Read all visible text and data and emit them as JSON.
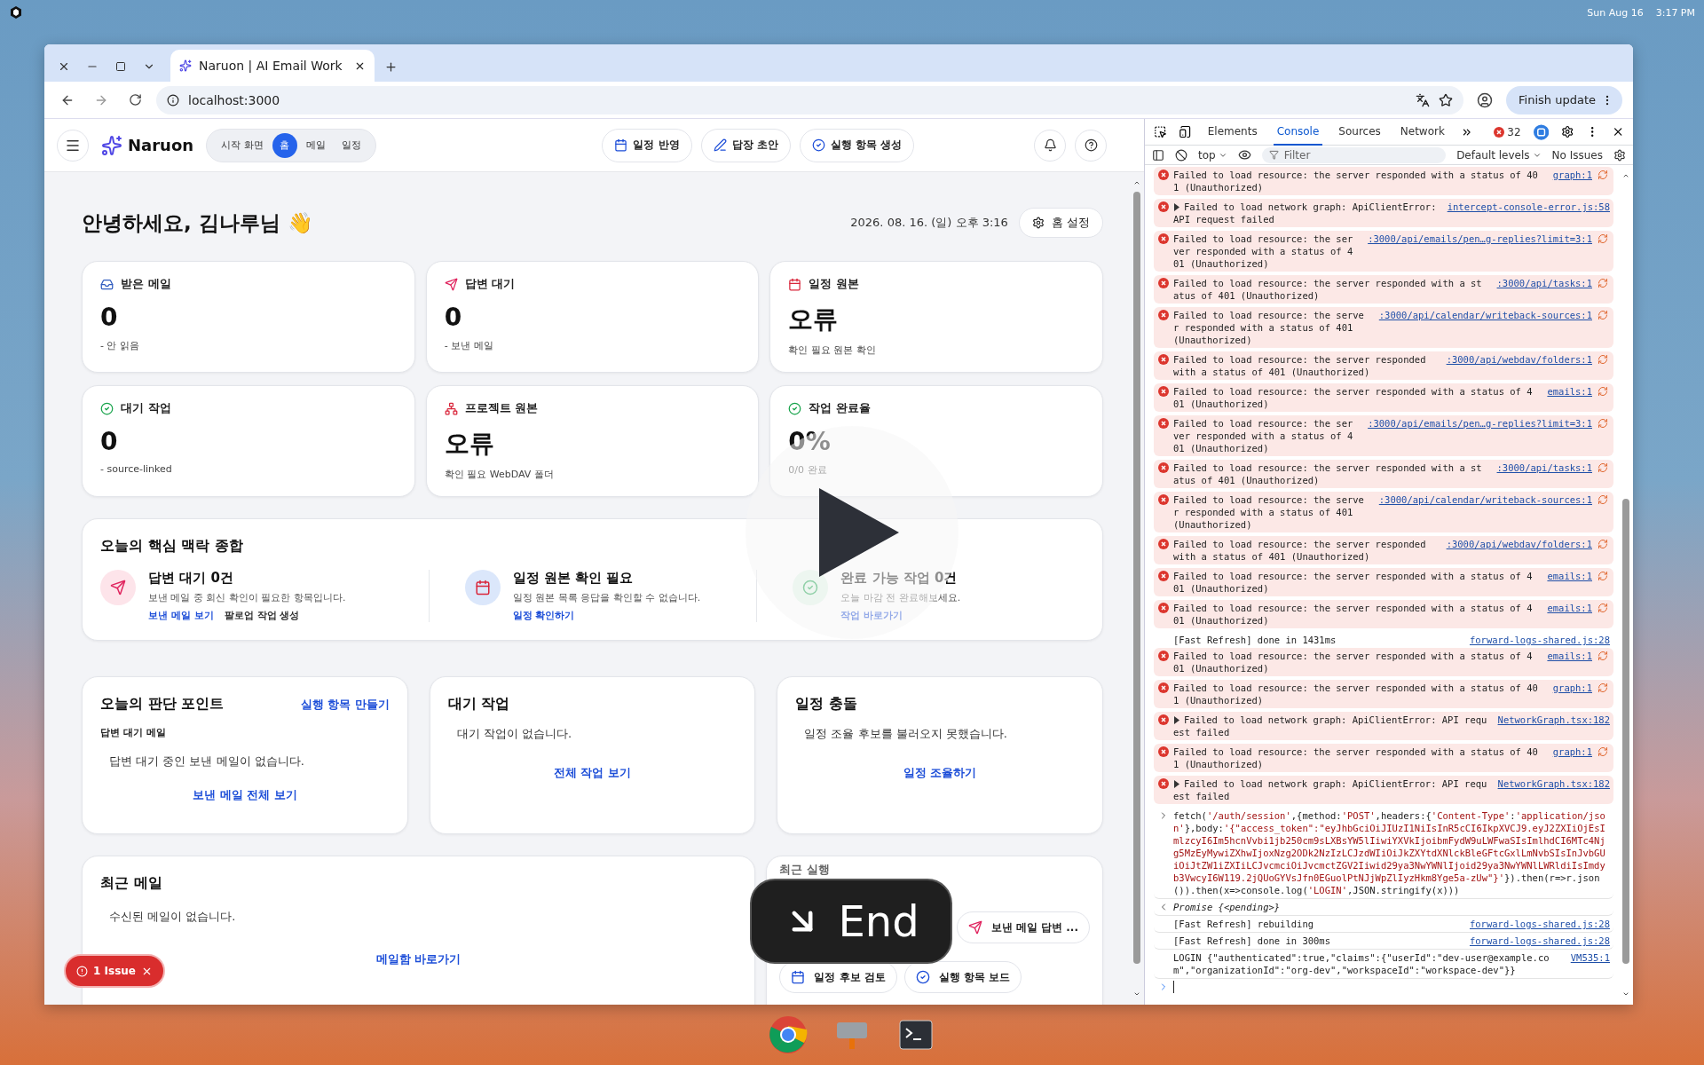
{
  "desktop": {
    "date": "Sun Aug 16",
    "time": "3:17 PM"
  },
  "browser": {
    "tab_title": "Naruon | AI Email Work",
    "address": "localhost:3000",
    "update_button": "Finish update"
  },
  "app": {
    "brand": "Naruon",
    "nav": [
      {
        "label": "시작 화면",
        "selected": false
      },
      {
        "label": "홈",
        "selected": true
      },
      {
        "label": "메일",
        "selected": false
      },
      {
        "label": "일정",
        "selected": false
      }
    ],
    "actions": [
      {
        "label": "일정 반영",
        "kind": "calendar"
      },
      {
        "label": "답장 초안",
        "kind": "pen"
      },
      {
        "label": "실행 항목 생성",
        "kind": "check"
      }
    ],
    "greeting": "안녕하세요, 김나루님 👋",
    "datetime": "2026. 08. 16. (일) 오후 3:16",
    "settings_button": "홈 설정",
    "stats": [
      {
        "label": "받은 메일",
        "value": "0",
        "sub": "- 안 읽음",
        "kind": "inbox"
      },
      {
        "label": "답변 대기",
        "value": "0",
        "sub": "- 보낸 메일",
        "kind": "send"
      },
      {
        "label": "일정 원본",
        "value": "오류",
        "sub": "확인 필요 원본 확인",
        "kind": "calendar"
      },
      {
        "label": "대기 작업",
        "value": "0",
        "sub": "- source-linked",
        "kind": "check"
      },
      {
        "label": "프로젝트 원본",
        "value": "오류",
        "sub": "확인 필요 WebDAV 폴더",
        "kind": "network"
      },
      {
        "label": "작업 완료율",
        "value": "0%",
        "sub": "0/0 완료",
        "kind": "check"
      }
    ],
    "context": {
      "title": "오늘의 핵심 맥락 종합",
      "items": [
        {
          "kind": "send",
          "title": "답변 대기 0건",
          "desc": "보낸 메일 중 회신 확인이 필요한 항목입니다.",
          "links": [
            {
              "label": "보낸 메일 보기",
              "primary": true
            },
            {
              "label": "팔로업 작업 생성",
              "primary": false
            }
          ]
        },
        {
          "kind": "calendar",
          "title": "일정 원본 확인 필요",
          "desc": "일정 원본 목록 응답을 확인할 수 없습니다.",
          "links": [
            {
              "label": "일정 확인하기",
              "primary": true
            }
          ]
        },
        {
          "kind": "check",
          "title": "완료 가능 작업 0건",
          "desc": "오늘 마감 전 완료해보세요.",
          "links": [
            {
              "label": "작업 바로가기",
              "primary": true
            }
          ]
        }
      ]
    },
    "panels": [
      {
        "title": "오늘의 판단 포인트",
        "action": "실행 항목 만들기",
        "subtitle": "답변 대기 메일",
        "message": "답변 대기 중인 보낸 메일이 없습니다.",
        "link": "보낸 메일 전체 보기"
      },
      {
        "title": "대기 작업",
        "message": "대기 작업이 없습니다.",
        "link": "전체 작업 보기"
      },
      {
        "title": "일정 충돌",
        "message": "일정 조율 후보를 불러오지 못했습니다.",
        "link": "일정 조율하기"
      }
    ],
    "recent_mail": {
      "title": "최근 메일",
      "message": "수신된 메일이 없습니다.",
      "link": "메일함 바로가기"
    },
    "recent_runs": {
      "title": "최근 실행",
      "buttons": [
        {
          "label": "보낸 메일 답변 ...",
          "kind": "send"
        },
        {
          "label": "일정 후보 검토",
          "kind": "calendar"
        },
        {
          "label": "실행 항목 보드",
          "kind": "check"
        }
      ]
    },
    "issue_badge": "1 Issue"
  },
  "devtools": {
    "tabs": [
      {
        "label": "Elements",
        "selected": false
      },
      {
        "label": "Console",
        "selected": true
      },
      {
        "label": "Sources",
        "selected": false
      },
      {
        "label": "Network",
        "selected": false
      }
    ],
    "error_count": "32",
    "context": "top",
    "filter_placeholder": "Filter",
    "levels": "Default levels",
    "issues": "No Issues",
    "messages": [
      {
        "kind": "resource_error",
        "text": "Failed to load resource: the server responded with a status of 401 (Unauthorized)",
        "source": "graph:1"
      },
      {
        "kind": "error",
        "expandable": true,
        "text": "Failed to load network graph: ApiClientError: API request failed",
        "source": "intercept-console-error.js:58"
      },
      {
        "kind": "resource_error",
        "text": "Failed to load resource: the server responded with a status of 401 (Unauthorized)",
        "source": ":3000/api/emails/pen…g-replies?limit=3:1"
      },
      {
        "kind": "resource_error",
        "text": "Failed to load resource: the server responded with a status of 401 (Unauthorized)",
        "source": ":3000/api/tasks:1"
      },
      {
        "kind": "resource_error",
        "text": "Failed to load resource: the server responded with a status of 401 (Unauthorized)",
        "source": ":3000/api/calendar/writeback-sources:1"
      },
      {
        "kind": "resource_error",
        "text": "Failed to load resource: the server responded with a status of 401 (Unauthorized)",
        "source": ":3000/api/webdav/folders:1"
      },
      {
        "kind": "resource_error",
        "text": "Failed to load resource: the server responded with a status of 401 (Unauthorized)",
        "source": "emails:1"
      },
      {
        "kind": "resource_error",
        "text": "Failed to load resource: the server responded with a status of 401 (Unauthorized)",
        "source": ":3000/api/emails/pen…g-replies?limit=3:1"
      },
      {
        "kind": "resource_error",
        "text": "Failed to load resource: the server responded with a status of 401 (Unauthorized)",
        "source": ":3000/api/tasks:1"
      },
      {
        "kind": "resource_error",
        "text": "Failed to load resource: the server responded with a status of 401 (Unauthorized)",
        "source": ":3000/api/calendar/writeback-sources:1"
      },
      {
        "kind": "resource_error",
        "text": "Failed to load resource: the server responded with a status of 401 (Unauthorized)",
        "source": ":3000/api/webdav/folders:1"
      },
      {
        "kind": "resource_error",
        "text": "Failed to load resource: the server responded with a status of 401 (Unauthorized)",
        "source": "emails:1"
      },
      {
        "kind": "resource_error",
        "text": "Failed to load resource: the server responded with a status of 401 (Unauthorized)",
        "source": "emails:1"
      },
      {
        "kind": "log",
        "text": "[Fast Refresh] done in 1431ms",
        "source": "forward-logs-shared.js:28"
      },
      {
        "kind": "resource_error",
        "text": "Failed to load resource: the server responded with a status of 401 (Unauthorized)",
        "source": "emails:1"
      },
      {
        "kind": "resource_error",
        "text": "Failed to load resource: the server responded with a status of 401 (Unauthorized)",
        "source": "graph:1"
      },
      {
        "kind": "error",
        "expandable": true,
        "text": "Failed to load network graph: ApiClientError: API request failed",
        "source": "NetworkGraph.tsx:182"
      },
      {
        "kind": "resource_error",
        "text": "Failed to load resource: the server responded with a status of 401 (Unauthorized)",
        "source": "graph:1"
      },
      {
        "kind": "error",
        "expandable": true,
        "text": "Failed to load network graph: ApiClientError: API request failed",
        "source": "NetworkGraph.tsx:182"
      },
      {
        "kind": "input",
        "segments": [
          {
            "kind": "code",
            "text": "fetch("
          },
          {
            "kind": "string",
            "text": "'/auth/session'"
          },
          {
            "kind": "code",
            "text": ",{method:"
          },
          {
            "kind": "string",
            "text": "'POST'"
          },
          {
            "kind": "code",
            "text": ",headers:{"
          },
          {
            "kind": "string",
            "text": "'Content-Type'"
          },
          {
            "kind": "code",
            "text": ":"
          },
          {
            "kind": "string",
            "text": "'application/json'"
          },
          {
            "kind": "code",
            "text": "},body:"
          },
          {
            "kind": "string",
            "text": "'{\"access_token\":\"eyJhbGciOiJIUzI1NiIsInR5cCI6IkpXVCJ9.eyJ2ZXIiOjEsImlzcyI6Im5hcnVvbi1jb250cm9sLXBsYW5lIiwiYXVkIjoibmFydW9uLWFwaSIsImlhdCI6MTc4Njg5MzEyMywiZXhwIjoxNzg2ODk2NzIzLCJzdWIiOiJkZXYtdXNlckBleGFtcGxlLmNvbSIsInJvbGUiOiJtZW1iZXIiLCJvcmciOiJvcmctZGV2Iiwid29ya3NwYWNlIjoid29ya3NwYWNlLWRldiIsImdyb3VwcyI6W119.2jQUoGYVsJfn0EGuolPtNJjWpZlIyzHkm8Yge5a-zUw\"}'"
          },
          {
            "kind": "code",
            "text": "}).then(r=>r.json()).then(x=>console.log("
          },
          {
            "kind": "string",
            "text": "'LOGIN'"
          },
          {
            "kind": "code",
            "text": ",JSON.stringify(x)))"
          }
        ]
      },
      {
        "kind": "result",
        "text": "Promise {<pending>}"
      },
      {
        "kind": "log",
        "text": "[Fast Refresh] rebuilding",
        "source": "forward-logs-shared.js:28"
      },
      {
        "kind": "log",
        "text": "[Fast Refresh] done in 300ms",
        "source": "forward-logs-shared.js:28"
      },
      {
        "kind": "log",
        "text": "LOGIN {\"authenticated\":true,\"claims\":{\"userId\":\"dev-user@example.com\",\"organizationId\":\"org-dev\",\"workspaceId\":\"workspace-dev\"}}",
        "source": "VM535:1"
      }
    ]
  },
  "overlay": {
    "end_button": "End"
  }
}
